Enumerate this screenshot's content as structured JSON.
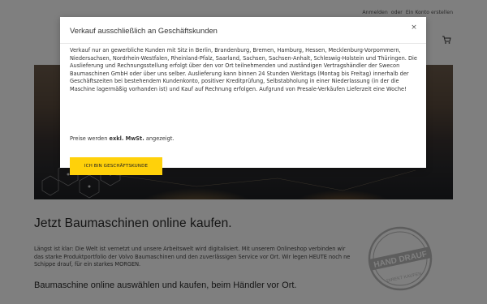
{
  "topbar": {
    "login": "Anmelden",
    "separator": "oder",
    "register": "Ein Konto erstellen"
  },
  "nav": {
    "cart_icon": "shopping-cart-icon"
  },
  "main": {
    "heading": "Jetzt Baumaschinen online kaufen.",
    "intro": "Längst ist klar: Die Welt ist vernetzt und unsere Arbeitswelt wird digitalisiert. Mit unserem Onlineshop verbinden wir das starke Produktportfolio der Volvo Baumaschinen und den zuverlässigen Service vor Ort. Wir legen HEUTE noch ne Schippe drauf, für ein starkes MORGEN.",
    "subheading": "Baumaschine online auswählen und kaufen, beim Händler vor Ort.",
    "stamp": {
      "line1": "HAND DRAUF",
      "line2": "DIREKT KAUFEN"
    }
  },
  "modal": {
    "title": "Verkauf ausschließlich an Geschäftskunden",
    "body": "Verkauf nur an gewerbliche Kunden mit Sitz in Berlin, Brandenburg, Bremen, Hamburg, Hessen, Mecklenburg-Vorpommern, Niedersachsen, Nordrhein-Westfalen, Rheinland-Pfalz, Saarland, Sachsen, Sachsen-Anhalt, Schleswig-Holstein und Thüringen. Die Auslieferung und Rechnungsstellung erfolgt über den vor Ort teilnehmenden und zuständigen Vertragshändler der Swecon Baumaschinen GmbH oder über uns selber. Auslieferung kann binnen 24 Stunden Werktags (Montag bis Freitag) innerhalb der Geschäftszeiten bei bestehendem Kundenkonto, positiver Kreditprüfung, Selbstabholung in einer Niederlassung (in der die Maschine lagermäßig vorhanden ist) und Kauf auf Rechnung erfolgen. Aufgrund von Presale-Verkäufen Lieferzeit eine Woche!",
    "price_prefix": "Preise werden",
    "price_bold": "exkl. MwSt.",
    "price_suffix": "angezeigt.",
    "close_label": "×",
    "confirm_label": "ICH BIN GESCHÄFTSKUNDE"
  },
  "colors": {
    "accent": "#ffd10a",
    "overlay": "rgba(0,0,0,0.5)"
  }
}
